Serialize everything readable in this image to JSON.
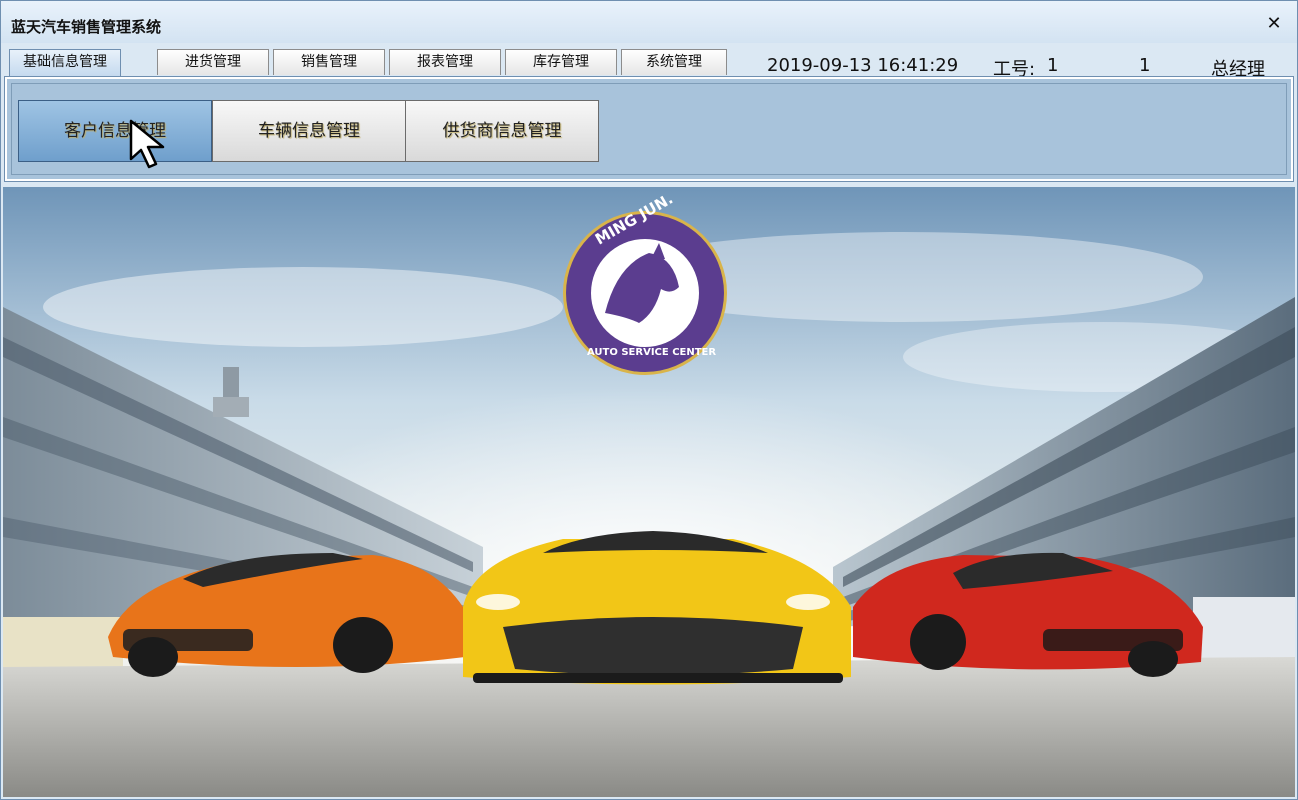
{
  "window": {
    "title": "蓝天汽车销售管理系统",
    "close_icon": "close-icon"
  },
  "tabs": [
    {
      "label": "基础信息管理",
      "active": true
    },
    {
      "label": "进货管理",
      "active": false
    },
    {
      "label": "销售管理",
      "active": false
    },
    {
      "label": "报表管理",
      "active": false
    },
    {
      "label": "库存管理",
      "active": false
    },
    {
      "label": "系统管理",
      "active": false
    }
  ],
  "status": {
    "datetime": "2019-09-13 16:41:29",
    "employee_label": "工号:",
    "employee_no": "1",
    "count": "1",
    "role": "总经理"
  },
  "sub_buttons": [
    {
      "label": "客户信息管理",
      "hover": true
    },
    {
      "label": "车辆信息管理",
      "hover": false
    },
    {
      "label": "供货商信息管理",
      "hover": false
    }
  ],
  "logo": {
    "top_text": "MING JUN.",
    "bottom_text": "AUTO SERVICE CENTER",
    "ring_color": "#5b3d8f",
    "inner_color": "#ffffff",
    "border_color": "#d9b44a"
  },
  "hero_image": {
    "description": "race-track-with-three-sports-cars",
    "car_colors": [
      "#e8741a",
      "#f2c617",
      "#d0281e"
    ]
  }
}
